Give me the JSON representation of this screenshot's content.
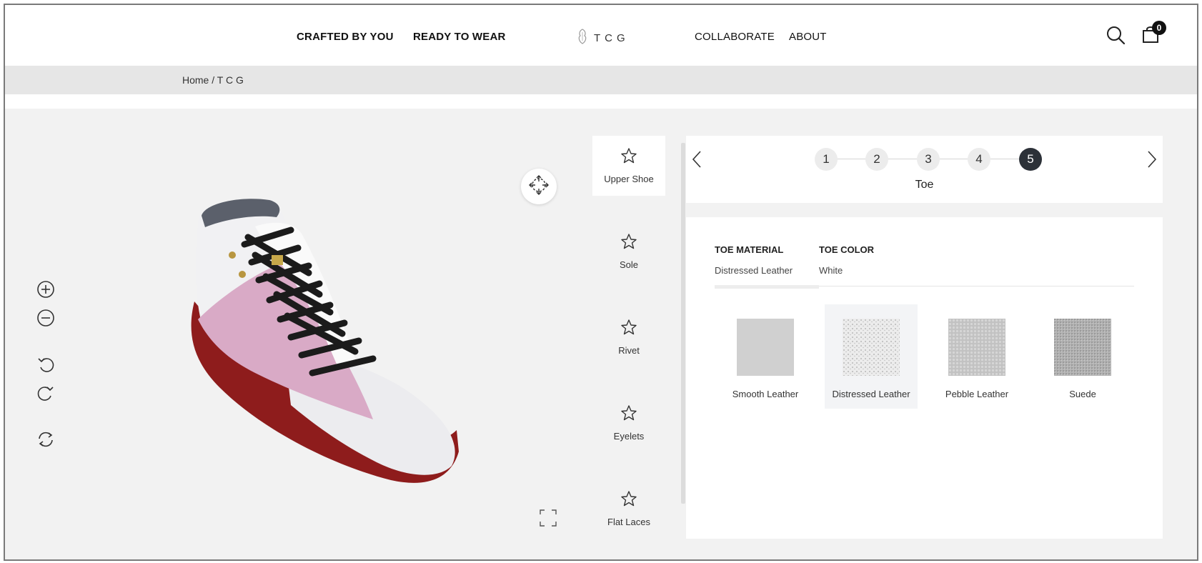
{
  "header": {
    "nav_left": [
      "CRAFTED BY YOU",
      "READY TO WEAR"
    ],
    "logo_text": "TCG",
    "nav_right": [
      "COLLABORATE",
      "ABOUT"
    ],
    "cart_count": "0",
    "icons": {
      "search": "search-icon",
      "cart": "shopping-bag-icon",
      "logo": "tcg-logo-icon"
    }
  },
  "breadcrumb": {
    "home": "Home",
    "separator": "/",
    "current": "T C G"
  },
  "viewer": {
    "tools": [
      "zoom-in-icon",
      "zoom-out-icon",
      "rotate-left-icon",
      "rotate-right-icon",
      "reset-view-icon"
    ],
    "move_icon": "move-icon",
    "fullscreen_icon": "fullscreen-icon"
  },
  "parts": [
    {
      "label": "Upper Shoe",
      "icon": "star-icon",
      "active": true
    },
    {
      "label": "Sole",
      "icon": "star-icon",
      "active": false
    },
    {
      "label": "Rivet",
      "icon": "star-icon",
      "active": false
    },
    {
      "label": "Eyelets",
      "icon": "star-icon",
      "active": false
    },
    {
      "label": "Flat Laces",
      "icon": "star-icon",
      "active": false
    }
  ],
  "steps": {
    "items": [
      "1",
      "2",
      "3",
      "4",
      "5"
    ],
    "active_index": 4,
    "title": "Toe"
  },
  "options": {
    "tabs": [
      {
        "title": "TOE MATERIAL",
        "value": "Distressed Leather"
      },
      {
        "title": "TOE COLOR",
        "value": "White"
      }
    ],
    "swatches": [
      {
        "label": "Smooth Leather",
        "active": false
      },
      {
        "label": "Distressed Leather",
        "active": true
      },
      {
        "label": "Pebble Leather",
        "active": false
      },
      {
        "label": "Suede",
        "active": false
      }
    ]
  },
  "colors": {
    "sole": "#8e1c1c",
    "panel_pink": "#d9aac6",
    "upper_white": "#f1f1f3",
    "laces": "#1b1b1b",
    "active_step": "#2c3138",
    "main_bg": "#f2f2f2"
  }
}
